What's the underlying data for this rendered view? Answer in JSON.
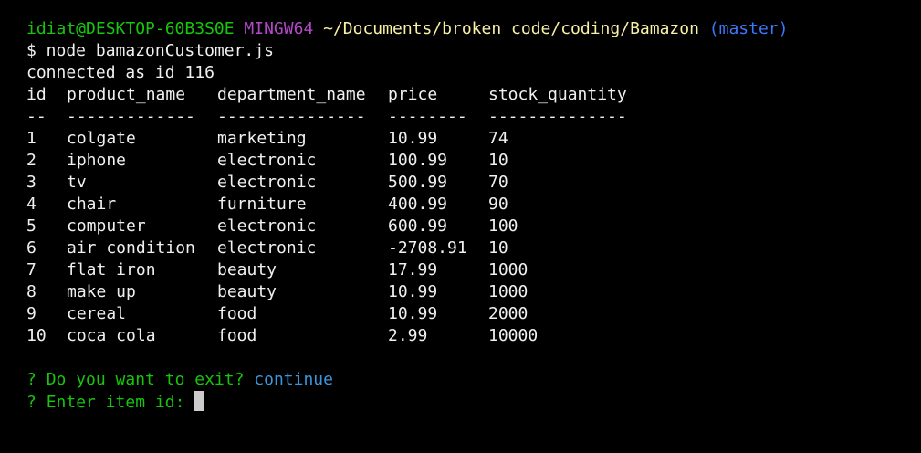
{
  "prompt": {
    "user_host": "idiat@DESKTOP-60B3S0E",
    "env": "MINGW64",
    "path": "~/Documents/broken code/coding/Bamazon",
    "branch": "(master)"
  },
  "command": "$ node bamazonCustomer.js",
  "connection_message": "connected as id 116",
  "table": {
    "headers": [
      "id",
      "product_name",
      "department_name",
      "price",
      "stock_quantity"
    ],
    "separators": [
      "--",
      "-------------",
      "---------------",
      "--------",
      "--------------"
    ],
    "rows": [
      [
        "1",
        "colgate",
        "marketing",
        "10.99",
        "74"
      ],
      [
        "2",
        "iphone",
        "electronic",
        "100.99",
        "10"
      ],
      [
        "3",
        "tv",
        "electronic",
        "500.99",
        "70"
      ],
      [
        "4",
        "chair",
        "furniture",
        "400.99",
        "90"
      ],
      [
        "5",
        "computer",
        "electronic",
        "600.99",
        "100"
      ],
      [
        "6",
        "air condition",
        "electronic",
        "-2708.91",
        "10"
      ],
      [
        "7",
        "flat iron",
        "beauty",
        "17.99",
        "1000"
      ],
      [
        "8",
        "make up",
        "beauty",
        "10.99",
        "1000"
      ],
      [
        "9",
        "cereal",
        "food",
        "10.99",
        "2000"
      ],
      [
        "10",
        "coca cola",
        "food",
        "2.99",
        "10000"
      ]
    ]
  },
  "questions": [
    {
      "mark": "?",
      "text": "Do you want to exit?",
      "answer": "continue"
    },
    {
      "mark": "?",
      "text": "Enter item id:",
      "answer": ""
    }
  ],
  "colors": {
    "background": "#000000",
    "user": "#16c60c",
    "env": "#b148c6",
    "path": "#f9f1a5",
    "branch": "#3b78ff",
    "answer": "#3a96dd"
  }
}
